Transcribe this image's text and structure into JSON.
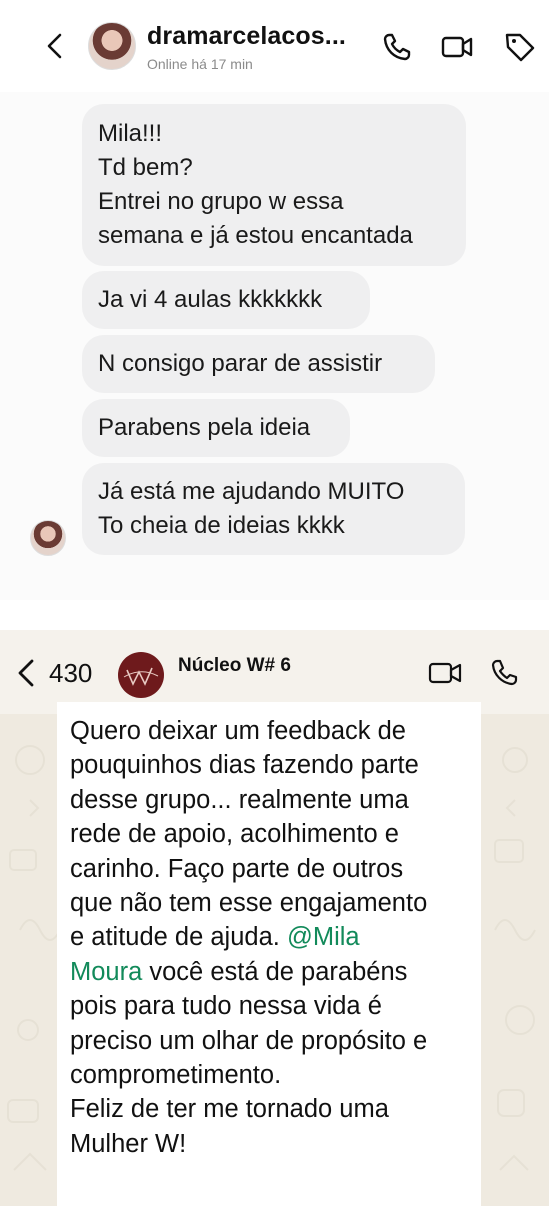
{
  "instagram": {
    "contact_name": "dramarcelacos...",
    "status": "Online há 17 min",
    "messages": [
      {
        "lines": [
          "Mila!!!",
          "Td bem?",
          "Entrei no grupo w essa",
          "semana e já estou encantada"
        ]
      },
      {
        "lines": [
          "Ja vi 4 aulas kkkkkkk"
        ]
      },
      {
        "lines": [
          "N consigo parar de assistir"
        ]
      },
      {
        "lines": [
          "Parabens pela ideia"
        ]
      },
      {
        "lines": [
          "Já está me ajudando MUITO",
          "To cheia de ideias kkkk"
        ]
      }
    ]
  },
  "whatsapp": {
    "back_count": "430",
    "group_name": "Núcleo W# 6",
    "message": {
      "lines": [
        "Quero deixar um feedback de",
        "pouquinhos dias fazendo parte",
        "desse grupo... realmente uma",
        "rede de apoio, acolhimento e",
        "carinho. Faço parte de outros",
        "que não tem esse engajamento",
        "e atitude de ajuda. ",
        "@Mila",
        "Moura",
        " você está de parabéns",
        "pois para tudo nessa vida é",
        "preciso um olhar de propósito e",
        "comprometimento.",
        "Feliz de ter me tornado uma",
        "Mulher W!"
      ]
    }
  },
  "colors": {
    "ig_bubble": "#efeff0",
    "wa_background": "#efeae0",
    "wa_mention": "#128a5a",
    "wa_group_avatar": "#6e1a1c"
  }
}
